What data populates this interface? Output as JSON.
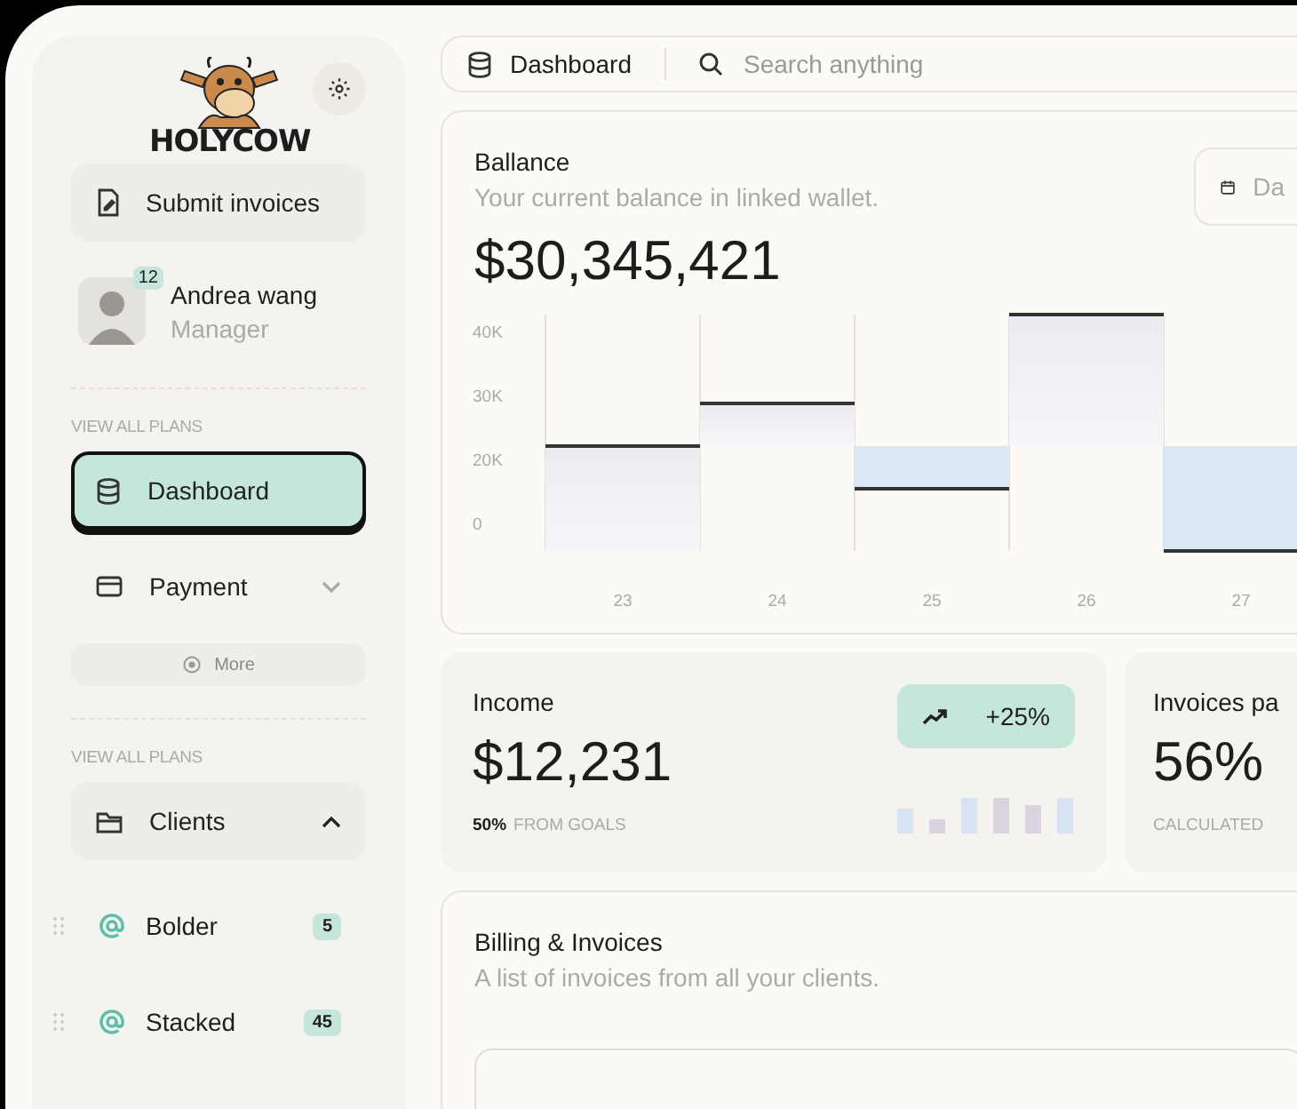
{
  "sidebar": {
    "logo_text": "HOLYCOW",
    "submit_button": "Submit invoices",
    "user": {
      "name": "Andrea wang",
      "role": "Manager",
      "badge": "12"
    },
    "sections": [
      {
        "heading": "VIEW ALL PLANS",
        "items": [
          {
            "kind": "link",
            "label": "Dashboard",
            "selected": true
          },
          {
            "kind": "dropdown",
            "label": "Payment",
            "selected": false,
            "expanded": false
          }
        ],
        "more_button": "More"
      },
      {
        "heading": "VIEW ALL PLANS",
        "items": [
          {
            "kind": "dropdown",
            "label": "Clients",
            "selected": false,
            "expanded": true,
            "children": [
              {
                "label": "Bolder",
                "count": "5"
              },
              {
                "label": "Stacked",
                "count": "45"
              }
            ]
          }
        ]
      }
    ]
  },
  "topbar": {
    "page": "Dashboard",
    "search": {
      "placeholder": "Search anything"
    }
  },
  "balance": {
    "title": "Ballance",
    "subtitle": "Your current balance in linked wallet.",
    "amount": "$30,345,421",
    "date_button": "Da",
    "y_axis_labels": [
      "40K",
      "30K",
      "20K",
      "0"
    ],
    "x_axis_labels": [
      "23",
      "24",
      "25",
      "26",
      "27"
    ]
  },
  "income": {
    "title": "Income",
    "amount": "$12,231",
    "trend": "+25%",
    "goal_percent": "50%",
    "goal_label": "FROM GOALS"
  },
  "invoices": {
    "title": "Invoices pa",
    "amount": "56%",
    "note": "CALCULATED"
  },
  "billing": {
    "title": "Billing & Invoices",
    "subtitle": "A list of invoices from all your clients."
  }
}
